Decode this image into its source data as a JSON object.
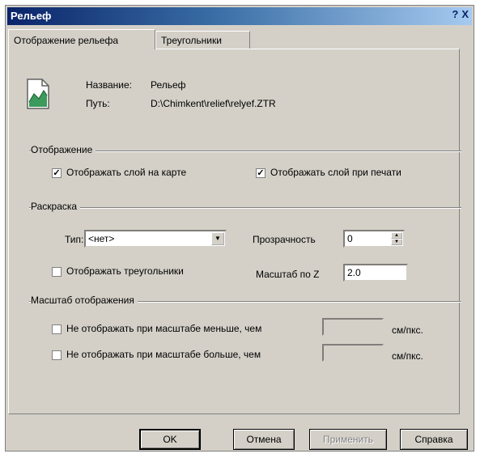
{
  "window": {
    "title": "Рельеф",
    "help": "?",
    "close": "X"
  },
  "tabs": [
    {
      "label": "Отображение рельефа",
      "active": true
    },
    {
      "label": "Треугольники",
      "active": false
    }
  ],
  "info": {
    "name_label": "Название:",
    "name_value": "Рельеф",
    "path_label": "Путь:",
    "path_value": "D:\\Chimkent\\relief\\relyef.ZTR"
  },
  "display": {
    "title": "Отображение",
    "show_on_map": {
      "label": "Отображать слой на карте",
      "checked": true
    },
    "show_on_print": {
      "label": "Отображать слой при печати",
      "checked": true
    }
  },
  "coloring": {
    "title": "Раскраска",
    "type_label": "Тип:",
    "type_value": "<нет>",
    "transparency_label": "Прозрачность",
    "transparency_value": "0",
    "show_triangles": {
      "label": "Отображать треугольники",
      "checked": false
    },
    "zscale_label": "Масштаб по Z",
    "zscale_value": "2.0"
  },
  "scale": {
    "title": "Масштаб отображения",
    "min": {
      "label": "Не отображать при масштабе меньше, чем",
      "checked": false,
      "value": "",
      "unit": "см/пкс."
    },
    "max": {
      "label": "Не отображать при масштабе больше, чем",
      "checked": false,
      "value": "",
      "unit": "см/пкс."
    }
  },
  "buttons": {
    "ok": "OK",
    "cancel": "Отмена",
    "apply": "Применить",
    "help": "Справка"
  }
}
